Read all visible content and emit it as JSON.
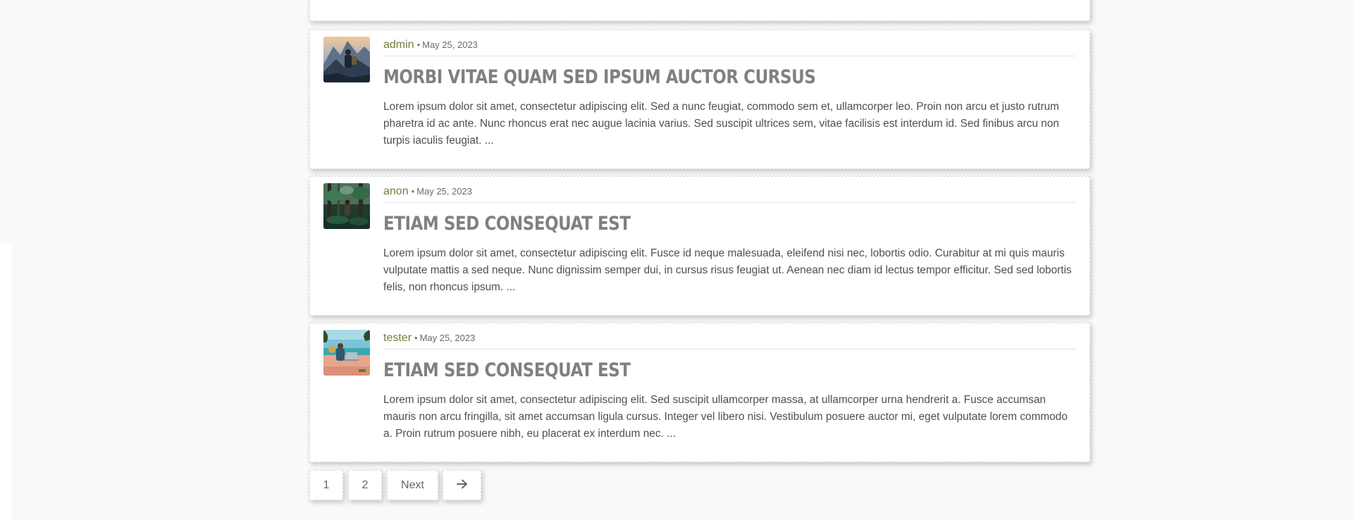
{
  "posts": [
    {
      "author": "admin",
      "separator": "•",
      "date": "May 25, 2023",
      "title": "Morbi vitae quam sed ipsum auctor cursus",
      "excerpt": "Lorem ipsum dolor sit amet, consectetur adipiscing elit. Sed a nunc feugiat, commodo sem et, ullamcorper leo. Proin non arcu et justo rutrum pharetra id ac ante. Nunc rhoncus erat nec augue lacinia varius. Sed suscipit ultrices sem, vitae facilisis est interdum id. Sed finibus arcu non turpis iaculis feugiat. ...",
      "thumbnail": "mountain-hiker-thumbnail"
    },
    {
      "author": "anon",
      "separator": "•",
      "date": "May 25, 2023",
      "title": "Etiam sed consequat est",
      "excerpt": "Lorem ipsum dolor sit amet, consectetur adipiscing elit. Fusce id neque malesuada, eleifend nisi nec, lobortis odio. Curabitur at mi quis mauris vulputate mattis a sed neque. Nunc dignissim semper dui, in cursus risus feugiat ut. Aenean nec diam id lectus tempor efficitur. Sed sed lobortis felis, non rhoncus ipsum. ...",
      "thumbnail": "jungle-figure-thumbnail"
    },
    {
      "author": "tester",
      "separator": "•",
      "date": "May 25, 2023",
      "title": "Etiam sed consequat est",
      "excerpt": "Lorem ipsum dolor sit amet, consectetur adipiscing elit. Sed suscipit ullamcorper massa, at ullamcorper urna hendrerit a. Fusce accumsan mauris non arcu fringilla, sit amet accumsan ligula cursus. Integer vel libero nisi. Vestibulum posuere auctor mi, eget vulputate lorem commodo a. Proin rutrum posuere nibh, eu placerat ex interdum nec. ...",
      "thumbnail": "beach-laptop-thumbnail"
    }
  ],
  "pagination": {
    "page1": "1",
    "page2": "2",
    "next": "Next",
    "arrow_icon": "arrow-right-icon"
  },
  "colors": {
    "author": "#7a7a3d",
    "title": "#808080",
    "text": "#4f4f4f",
    "page_background": "#f9f9f9"
  }
}
